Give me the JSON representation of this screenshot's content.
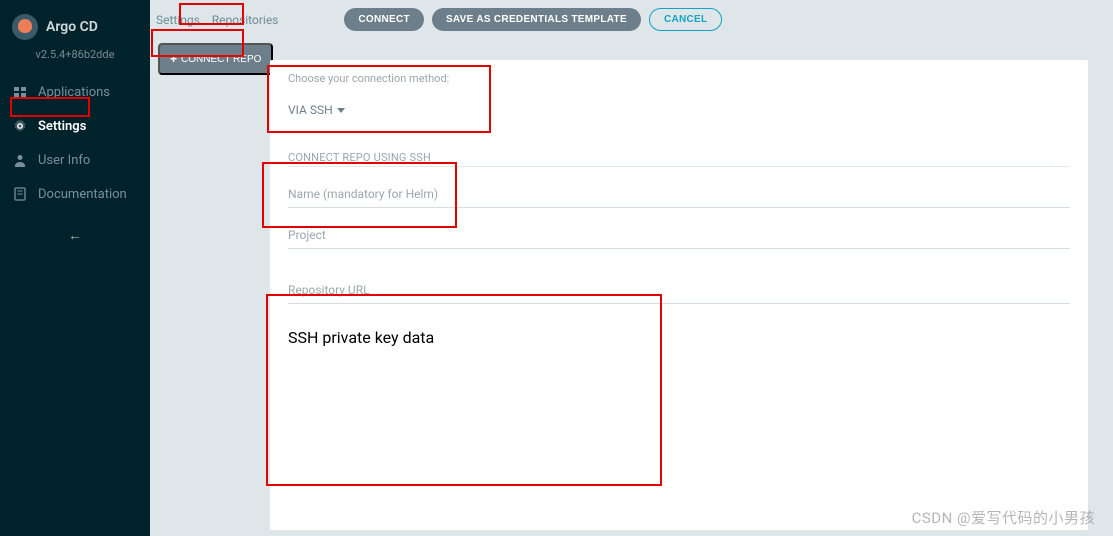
{
  "app": {
    "title": "Argo CD",
    "version": "v2.5.4+86b2dde"
  },
  "sidebar": {
    "items": [
      {
        "label": "Applications"
      },
      {
        "label": "Settings"
      },
      {
        "label": "User Info"
      },
      {
        "label": "Documentation"
      }
    ]
  },
  "breadcrumb": {
    "root": "Settings",
    "current": "Repositories"
  },
  "header_buttons": {
    "connect": "CONNECT",
    "save_template": "SAVE AS CREDENTIALS TEMPLATE",
    "cancel": "CANCEL",
    "connect_repo": "CONNECT REPO"
  },
  "form": {
    "method_label": "Choose your connection method:",
    "method_value": "VIA SSH",
    "section_title": "CONNECT REPO USING SSH",
    "fields": {
      "name_placeholder": "Name (mandatory for Helm)",
      "project_placeholder": "Project",
      "repo_url_placeholder": "Repository URL",
      "ssh_key_placeholder": "SSH private key data"
    }
  },
  "watermark": "CSDN @爱写代码的小男孩"
}
